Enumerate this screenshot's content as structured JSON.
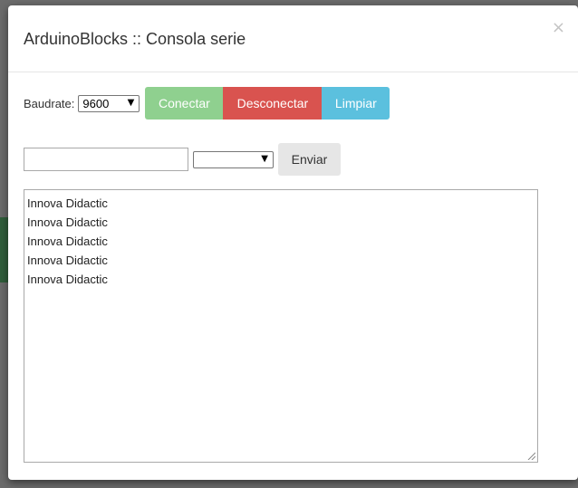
{
  "modal": {
    "title": "ArduinoBlocks :: Consola serie",
    "close_glyph": "×"
  },
  "baud": {
    "label": "Baudrate:",
    "selected": "9600",
    "arrow": "▼"
  },
  "buttons": {
    "connect": "Conectar",
    "disconnect": "Desconectar",
    "clear": "Limpiar",
    "send": "Enviar"
  },
  "send": {
    "input_value": "",
    "eol_selected": "",
    "arrow": "▼"
  },
  "console": {
    "lines": [
      "Innova Didactic",
      "Innova Didactic",
      "Innova Didactic",
      "Innova Didactic",
      "Innova Didactic"
    ]
  },
  "colors": {
    "connect": "#8fd08f",
    "disconnect": "#d9534f",
    "clear": "#5bc0de",
    "send": "#e6e6e6"
  },
  "icons": {
    "close": "close-icon",
    "select_arrow": "chevron-down-icon",
    "resize": "resize-grip-icon"
  }
}
